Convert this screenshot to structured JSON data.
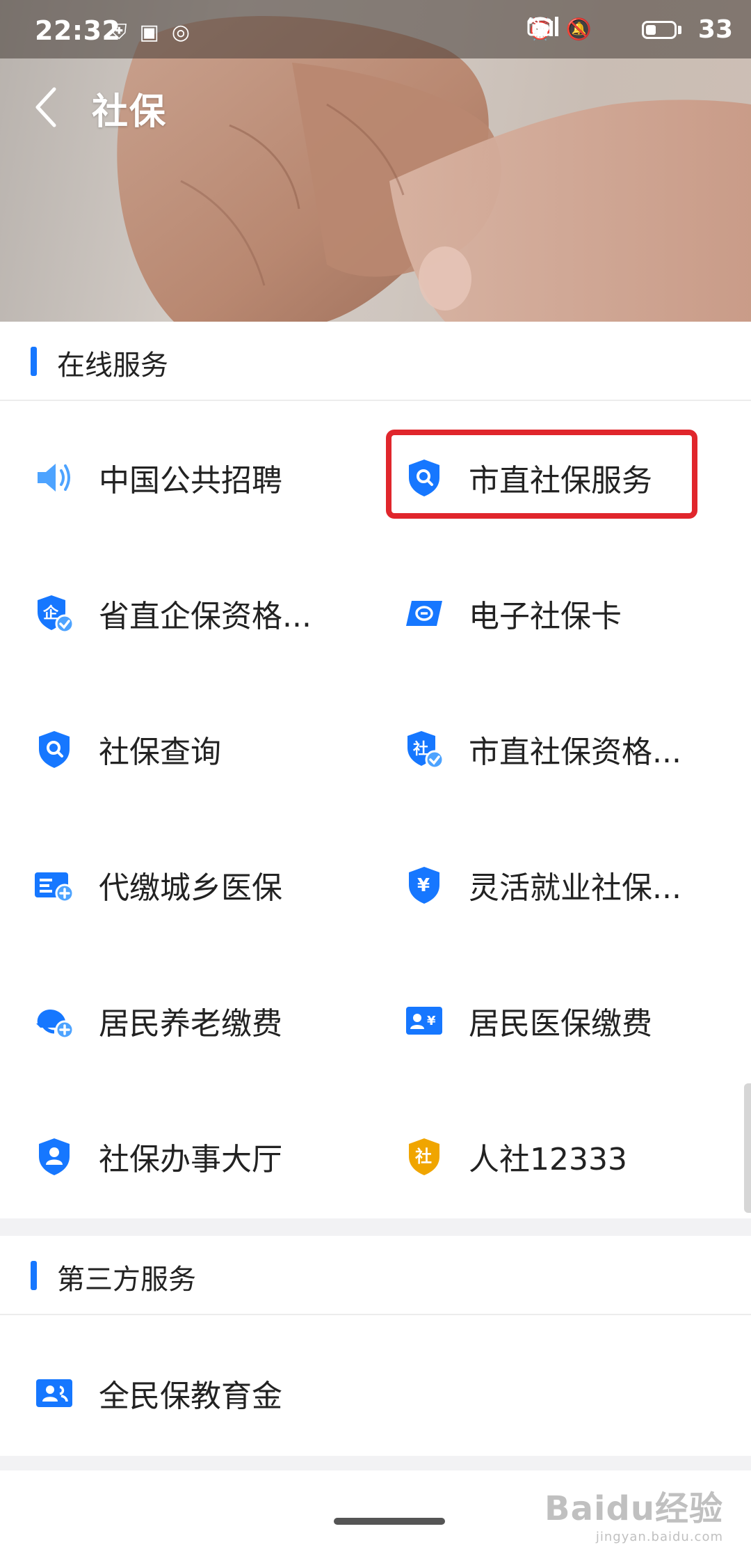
{
  "status_bar": {
    "time": "22:32",
    "battery_percent": "33",
    "network": "4G"
  },
  "header": {
    "title": "社保"
  },
  "sections": {
    "online": {
      "title": "在线服务",
      "items": [
        {
          "label": "中国公共招聘",
          "icon": "speaker-icon"
        },
        {
          "label": "市直社保服务",
          "icon": "shield-search-icon"
        },
        {
          "label": "省直企保资格...",
          "icon": "shield-check-icon"
        },
        {
          "label": "电子社保卡",
          "icon": "card-icon"
        },
        {
          "label": "社保查询",
          "icon": "shield-search-icon"
        },
        {
          "label": "市直社保资格...",
          "icon": "shield-check-icon"
        },
        {
          "label": "代缴城乡医保",
          "icon": "card-plus-icon"
        },
        {
          "label": "灵活就业社保...",
          "icon": "shield-yuan-icon"
        },
        {
          "label": "居民养老缴费",
          "icon": "cloud-plus-icon"
        },
        {
          "label": "居民医保缴费",
          "icon": "id-card-icon"
        },
        {
          "label": "社保办事大厅",
          "icon": "shield-user-icon"
        },
        {
          "label": "人社12333",
          "icon": "shield-she-icon"
        }
      ]
    },
    "third_party": {
      "title": "第三方服务",
      "items": [
        {
          "label": "全民保教育金",
          "icon": "users-card-icon"
        }
      ]
    }
  },
  "colors": {
    "accent": "#1677ff",
    "highlight": "#e0262c",
    "gold": "#f0a500"
  },
  "watermark": {
    "main": "Baidu经验",
    "sub": "jingyan.baidu.com"
  }
}
